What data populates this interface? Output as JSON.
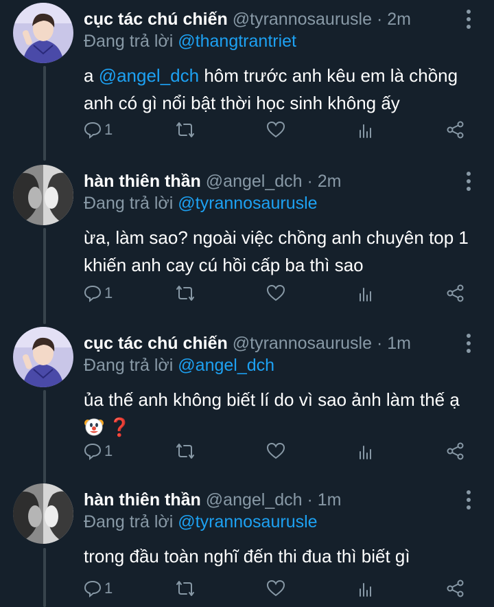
{
  "icons": {
    "reply": "reply-icon",
    "retweet": "retweet-icon",
    "like": "heart-icon",
    "analytics": "analytics-icon",
    "share": "share-icon",
    "more": "more-vertical-icon"
  },
  "colors": {
    "background": "#15202b",
    "text": "#ffffff",
    "muted": "#8899a6",
    "mention": "#1da1f2"
  },
  "tweets": [
    {
      "name": "cục tác chú chiến",
      "handle": "@tyrannosaurusle",
      "dot": "·",
      "time": "2m",
      "reply_label": "Đang trả lời",
      "reply_to": "@thangtrantriet",
      "text_mention": "@angel_dch",
      "text_prefix": "a",
      "text": "hôm trước anh kêu em là chồng anh có gì nổi bật thời học sinh không ấy",
      "reply_count": "1"
    },
    {
      "name": "hàn thiên thần",
      "handle": "@angel_dch",
      "dot": "·",
      "time": "2m",
      "reply_label": "Đang trả lời",
      "reply_to": "@tyrannosaurusle",
      "text": "ừa, làm sao? ngoài việc chồng anh chuyên top 1 khiến anh cay cú hồi cấp ba thì sao",
      "reply_count": "1"
    },
    {
      "name": "cục tác chú chiến",
      "handle": "@tyrannosaurusle",
      "dot": "·",
      "time": "1m",
      "reply_label": "Đang trả lời",
      "reply_to": "@angel_dch",
      "text": "ủa thế anh không biết lí do vì sao ảnh làm thế ạ",
      "emoji_q": "❓",
      "reply_count": "1"
    },
    {
      "name": "hàn thiên thần",
      "handle": "@angel_dch",
      "dot": "·",
      "time": "1m",
      "reply_label": "Đang trả lời",
      "reply_to": "@tyrannosaurusle",
      "text": "trong đầu toàn nghĩ đến thi đua thì biết gì",
      "reply_count": "1"
    }
  ]
}
